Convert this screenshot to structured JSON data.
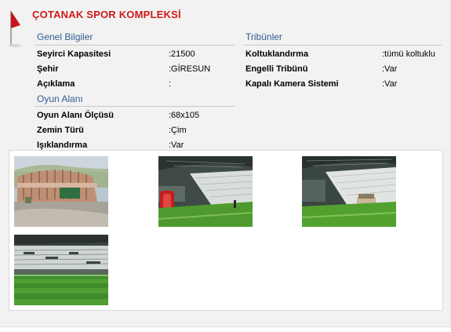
{
  "page": {
    "title": "ÇOTANAK SPOR KOMPLEKSİ"
  },
  "general": {
    "heading": "Genel Bilgiler",
    "rows": [
      {
        "label": "Seyirci Kapasitesi",
        "value": ":21500"
      },
      {
        "label": "Şehir",
        "value": ":GİRESUN"
      },
      {
        "label": "Açıklama",
        "value": ":"
      }
    ]
  },
  "field": {
    "heading": "Oyun Alanı",
    "rows": [
      {
        "label": "Oyun Alanı Ölçüsü",
        "value": ":68x105"
      },
      {
        "label": "Zemin Türü",
        "value": ":Çim"
      },
      {
        "label": "Işıklandırma",
        "value": ":Var"
      }
    ]
  },
  "stands": {
    "heading": "Tribünler",
    "rows": [
      {
        "label": "Koltuklandırma",
        "value": ":tümü koltuklu"
      },
      {
        "label": "Engelli Tribünü",
        "value": ":Var"
      },
      {
        "label": "Kapalı Kamera Sistemi",
        "value": ":Var"
      }
    ]
  },
  "colors": {
    "title": "#d01a1a",
    "heading": "#2f5d91",
    "grass": "#4f9a2e",
    "flag": "#c8141e"
  },
  "gallery": {
    "photos": [
      {
        "icon": "stadium-exterior-photo"
      },
      {
        "icon": "stadium-interior-photo"
      },
      {
        "icon": "stadium-interior-photo"
      },
      {
        "icon": "stadium-pitch-photo"
      }
    ]
  }
}
